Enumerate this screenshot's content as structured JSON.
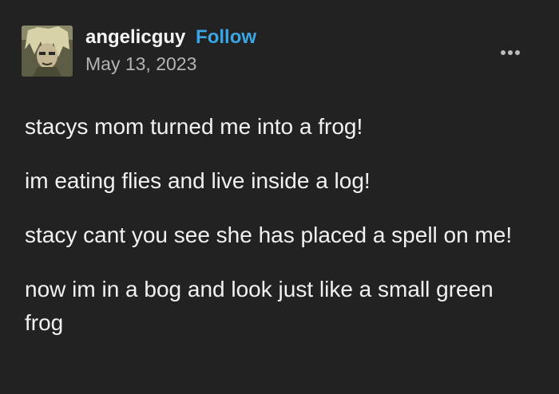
{
  "post": {
    "author": {
      "username": "angelicguy",
      "follow_label": "Follow",
      "avatar_icon": "user-avatar-icon"
    },
    "date": "May 13, 2023",
    "menu_icon": "more-horizontal-icon",
    "paragraphs": [
      "stacys mom turned me into a frog!",
      "im eating flies and live inside a log!",
      "stacy cant you see she has placed a spell on me!",
      "now im in a bog and look just like a small green frog"
    ]
  },
  "colors": {
    "background": "#222222",
    "text": "#f1f1f1",
    "muted": "#b4b4b4",
    "accent": "#39a6e6"
  }
}
